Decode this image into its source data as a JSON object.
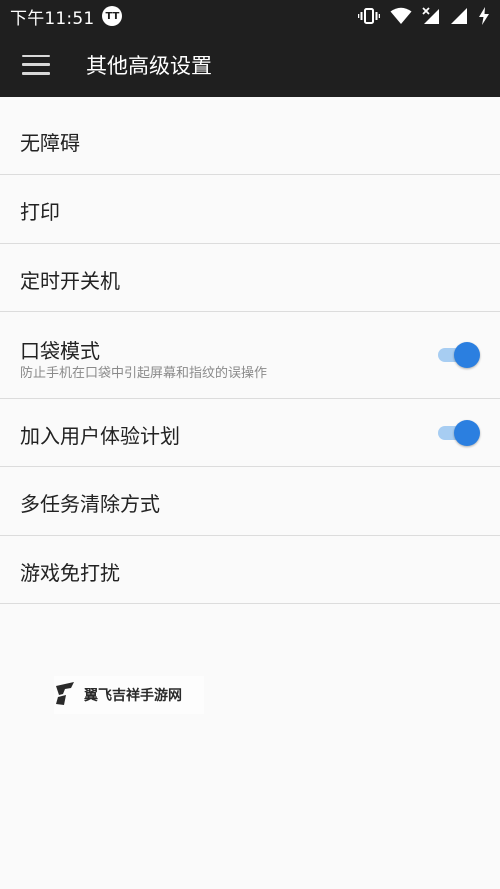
{
  "status_bar": {
    "time": "下午11:51",
    "app_icon": "TT",
    "icons": [
      "vibrate-icon",
      "wifi-icon",
      "signal-x-icon",
      "signal-icon",
      "charging-icon"
    ]
  },
  "app_bar": {
    "menu_icon": "menu-icon",
    "title": "其他高级设置"
  },
  "settings": [
    {
      "title": "无障碍"
    },
    {
      "title": "打印"
    },
    {
      "title": "定时开关机"
    },
    {
      "title": "口袋模式",
      "subtitle": "防止手机在口袋中引起屏幕和指纹的误操作",
      "toggle": true
    },
    {
      "title": "加入用户体验计划",
      "toggle": true
    },
    {
      "title": "多任务清除方式"
    },
    {
      "title": "游戏免打扰"
    }
  ],
  "watermark": {
    "text": "翼飞吉祥手游网"
  },
  "colors": {
    "app_bar_bg": "#1f1f1f",
    "accent": "#2b7fe0",
    "accent_track": "#a7cdf2",
    "background": "#fafafa"
  }
}
